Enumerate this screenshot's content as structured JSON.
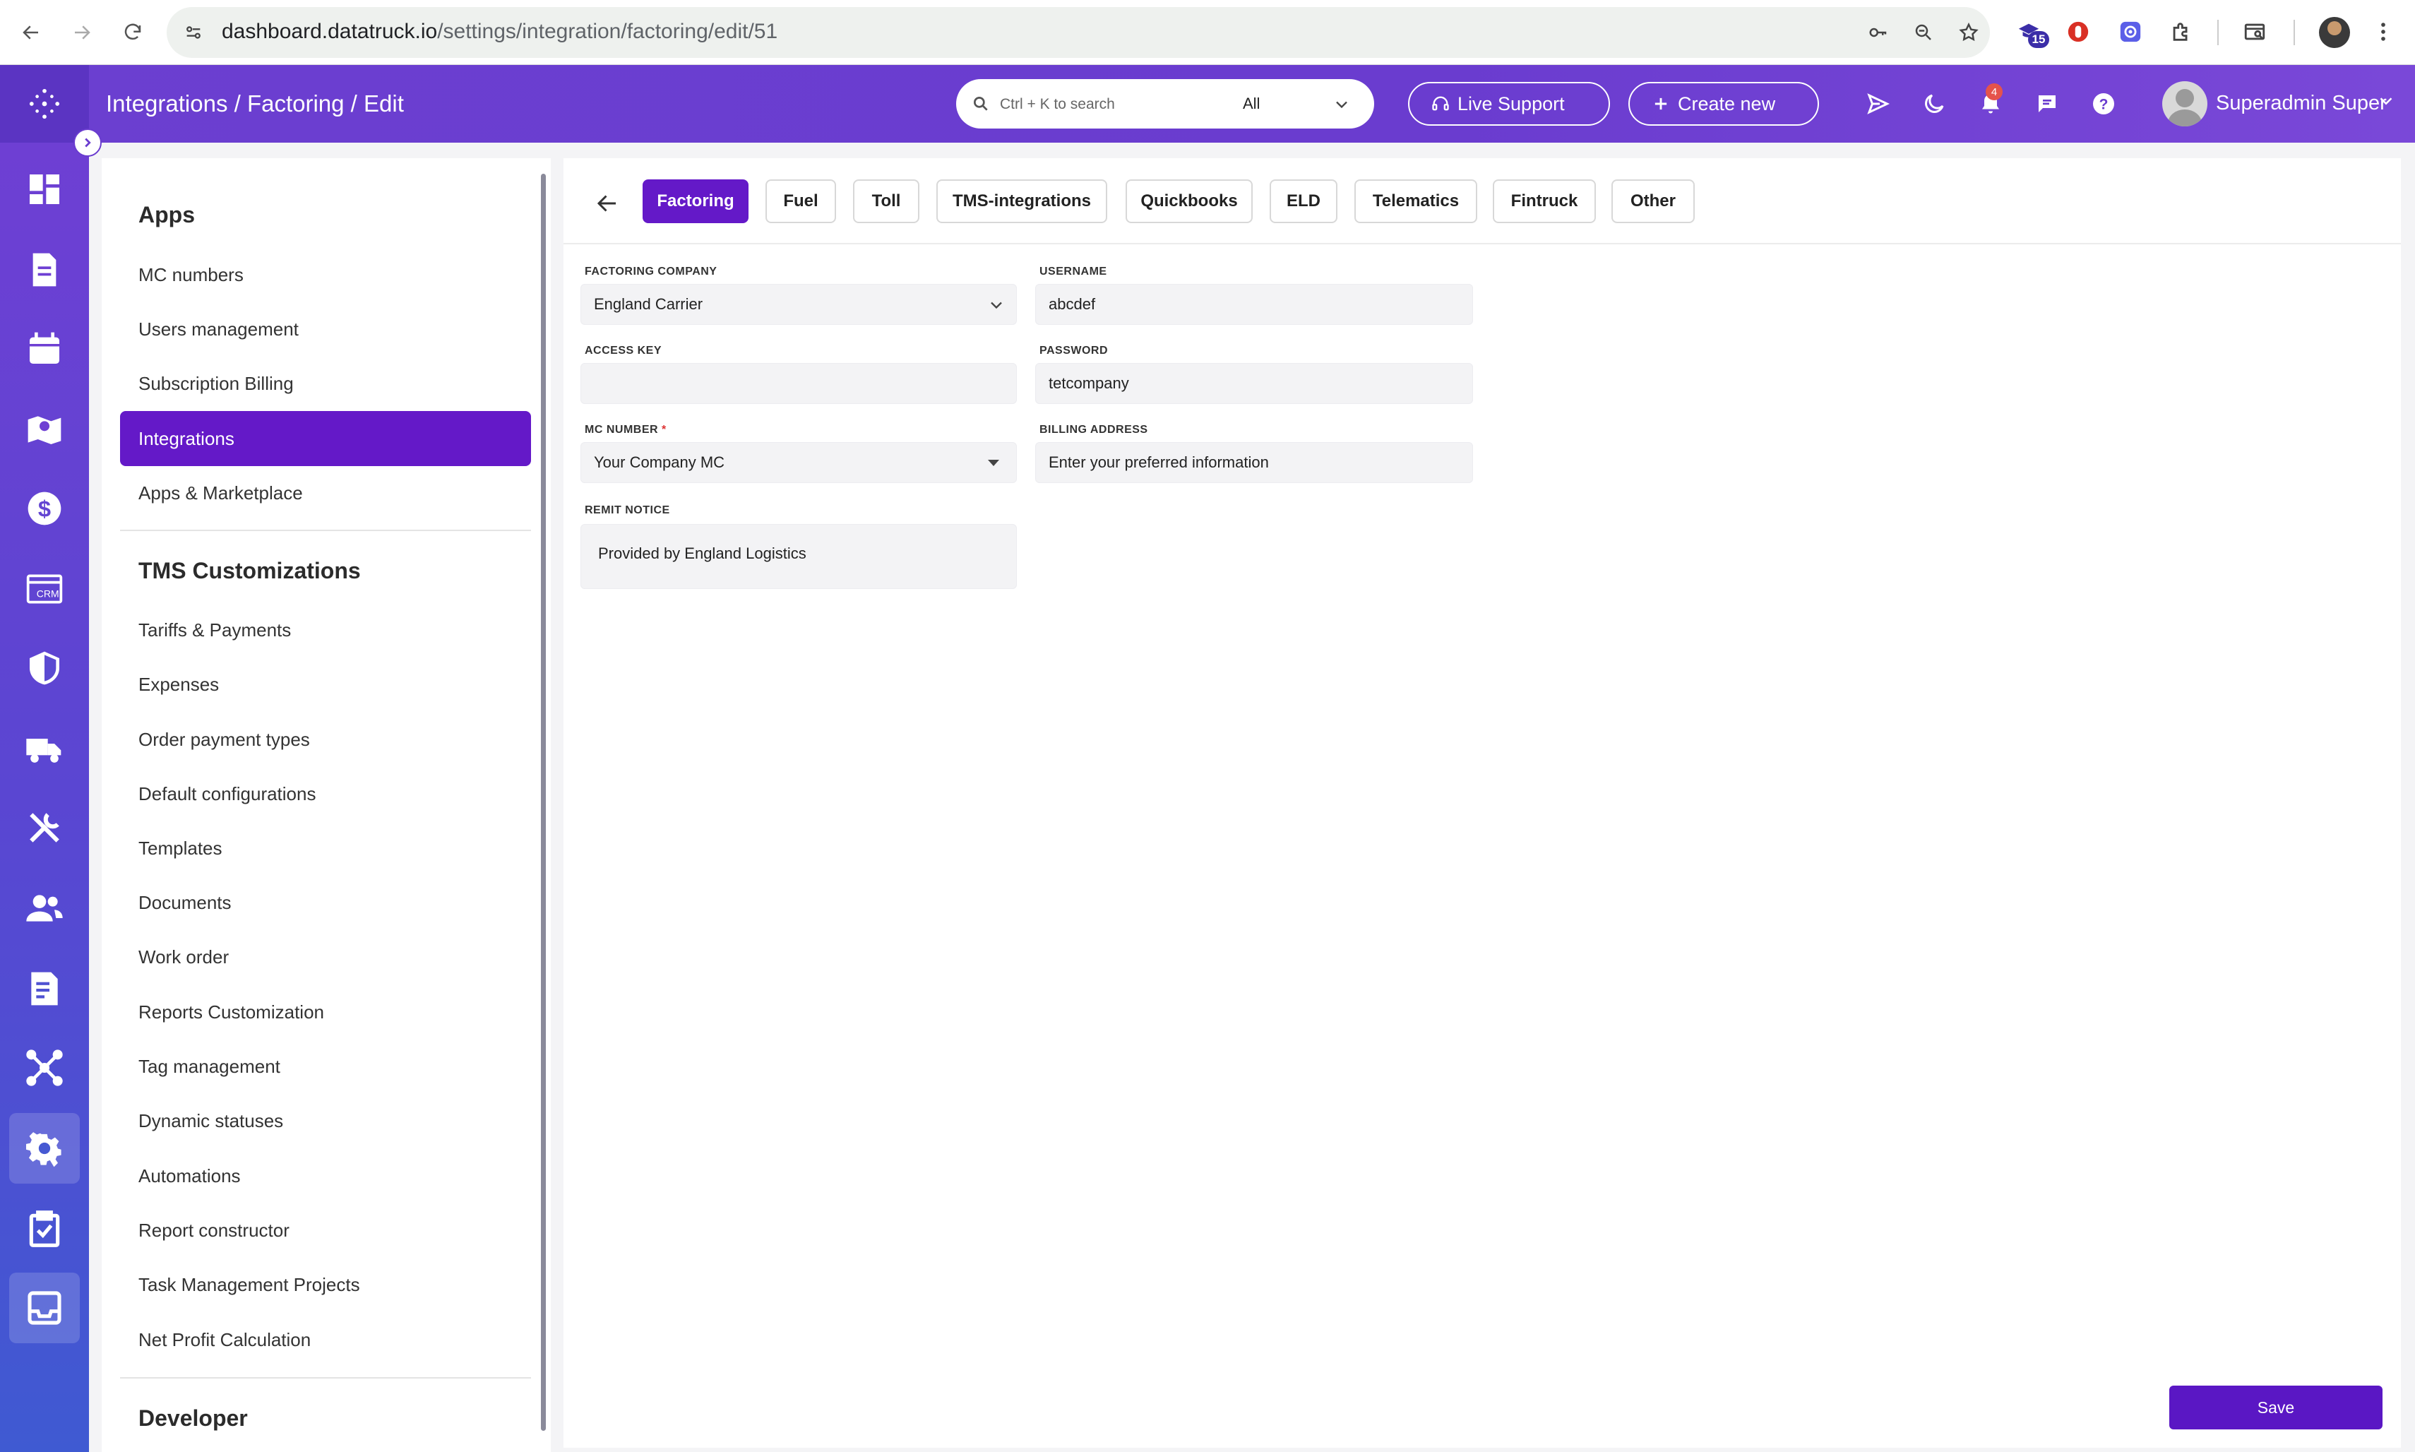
{
  "browser": {
    "url_host": "dashboard.datatruck.io",
    "url_path": "/settings/integration/factoring/edit/51",
    "extension_badge": "15"
  },
  "header": {
    "breadcrumb": "Integrations  /  Factoring / Edit",
    "search_placeholder": "Ctrl + K to search",
    "search_scope": "All",
    "live_support": "Live Support",
    "create_new": "Create new",
    "notification_count": "4",
    "user_name": "Superadmin Super"
  },
  "sidebar": {
    "apps_heading": "Apps",
    "apps_items": [
      {
        "label": "MC numbers"
      },
      {
        "label": "Users management"
      },
      {
        "label": "Subscription Billing"
      },
      {
        "label": "Integrations"
      },
      {
        "label": "Apps & Marketplace"
      }
    ],
    "tms_heading": "TMS Customizations",
    "tms_items": [
      {
        "label": "Tariffs & Payments"
      },
      {
        "label": "Expenses"
      },
      {
        "label": "Order payment types"
      },
      {
        "label": "Default configurations"
      },
      {
        "label": "Templates"
      },
      {
        "label": "Documents"
      },
      {
        "label": "Work order"
      },
      {
        "label": "Reports Customization"
      },
      {
        "label": "Tag management"
      },
      {
        "label": "Dynamic statuses"
      },
      {
        "label": "Automations"
      },
      {
        "label": "Report constructor"
      },
      {
        "label": "Task Management Projects"
      },
      {
        "label": "Net Profit Calculation"
      }
    ],
    "developer_heading": "Developer"
  },
  "tabs": [
    {
      "label": "Factoring"
    },
    {
      "label": "Fuel"
    },
    {
      "label": "Toll"
    },
    {
      "label": "TMS-integrations"
    },
    {
      "label": "Quickbooks"
    },
    {
      "label": "ELD"
    },
    {
      "label": "Telematics"
    },
    {
      "label": "Fintruck"
    },
    {
      "label": "Other"
    }
  ],
  "form": {
    "factoring_company": {
      "label": "FACTORING COMPANY",
      "value": "England Carrier"
    },
    "username": {
      "label": "USERNAME",
      "value": "abcdef"
    },
    "access_key": {
      "label": "ACCESS KEY",
      "value": ""
    },
    "password": {
      "label": "PASSWORD",
      "value": "tetcompany"
    },
    "mc_number": {
      "label": "MC NUMBER",
      "required_mark": "*",
      "value": "Your Company MC"
    },
    "billing_address": {
      "label": "BILLING ADDRESS",
      "value": "Enter your preferred information"
    },
    "remit_notice": {
      "label": "REMIT NOTICE",
      "value": "Provided by England Logistics"
    },
    "save_label": "Save"
  },
  "colors": {
    "accent": "#6419c8",
    "header_purple": "#6a3ccf",
    "save": "#5a17c4"
  }
}
